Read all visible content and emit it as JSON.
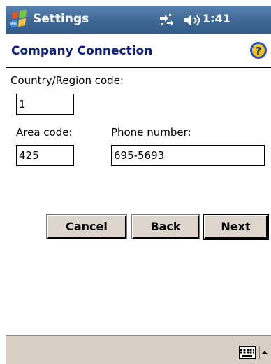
{
  "titlebar": {
    "app_title": "Settings",
    "clock": "1:41",
    "icons": [
      "windows-start-flag-icon",
      "connectivity-icon",
      "speaker-icon"
    ]
  },
  "header": {
    "page_title": "Company Connection",
    "help_icon": "help-question-icon"
  },
  "form": {
    "country_label": "Country/Region code:",
    "country_value": "1",
    "area_label": "Area code:",
    "area_value": "425",
    "phone_label": "Phone number:",
    "phone_value": "695-5693"
  },
  "buttons": {
    "cancel": "Cancel",
    "back": "Back",
    "next": "Next"
  },
  "bottombar": {
    "icons": [
      "keyboard-icon",
      "input-panel-arrow-icon"
    ]
  },
  "colors": {
    "titlebar": "#3f6796",
    "header_text": "#0b1f7d",
    "button_face": "#ded6cc",
    "bottombar": "#d8d0c6"
  }
}
